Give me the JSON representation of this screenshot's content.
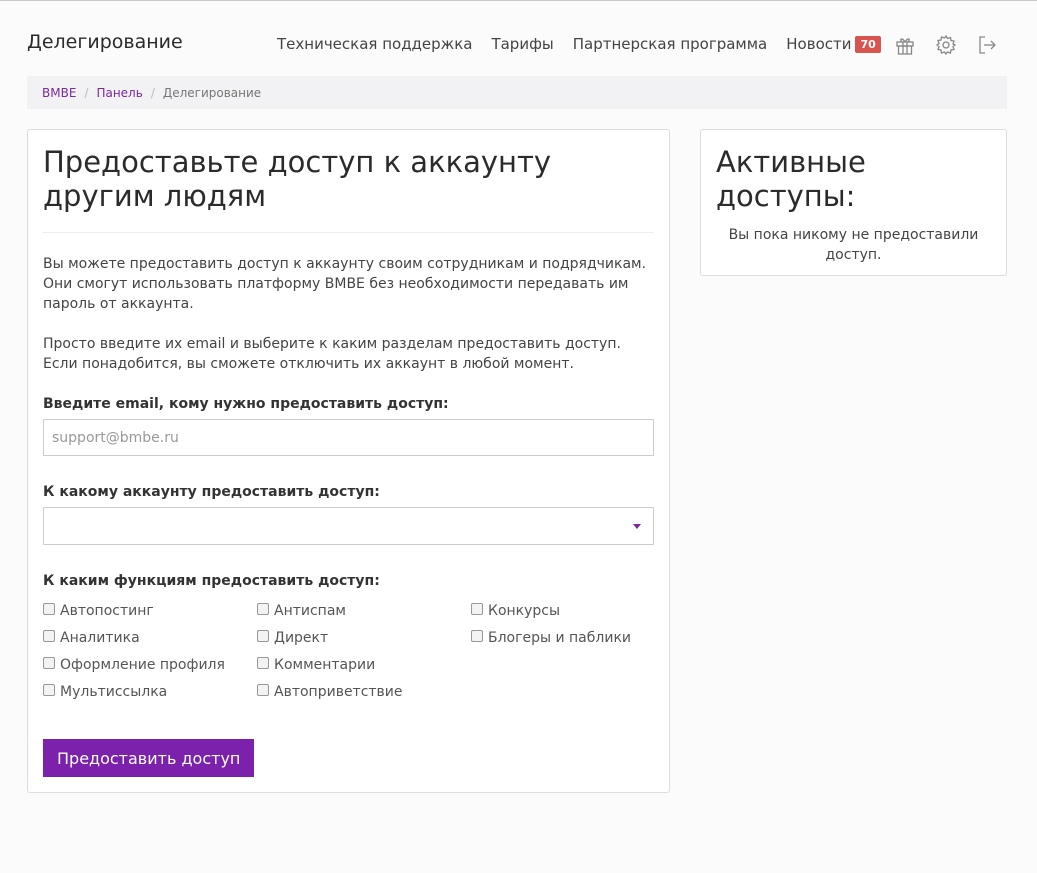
{
  "header": {
    "brand": "Делегирование",
    "nav": [
      "Техническая поддержка",
      "Тарифы",
      "Партнерская программа"
    ],
    "news_label": "Новости",
    "news_count": "70",
    "icons": [
      "gift-icon",
      "gear-icon",
      "logout-icon"
    ]
  },
  "breadcrumb": {
    "items": [
      "BMBE",
      "Панель",
      "Делегирование"
    ]
  },
  "main": {
    "title": "Предоставьте доступ к аккаунту другим людям",
    "para1_line1": "Вы можете предоставить доступ к аккаунту своим сотрудникам и подрядчикам.",
    "para1_line2": "Они смогут использовать платформу BMBE без необходимости передавать им пароль от аккаунта.",
    "para2_line1": "Просто введите их email и выберите к каким разделам предоставить доступ.",
    "para2_line2": "Если понадобится, вы сможете отключить их аккаунт в любой момент.",
    "email_label": "Введите email, кому нужно предоставить доступ:",
    "email_placeholder": "support@bmbe.ru",
    "email_value": "",
    "account_label": "К какому аккаунту предоставить доступ:",
    "account_value": "",
    "functions_label": "К каким функциям предоставить доступ:",
    "functions": [
      "Автопостинг",
      "Аналитика",
      "Оформление профиля",
      "Мультиссылка",
      "Антиспам",
      "Директ",
      "Комментарии",
      "Автоприветствие",
      "Конкурсы",
      "Блогеры и паблики"
    ],
    "submit_label": "Предоставить доступ"
  },
  "side": {
    "title": "Активные доступы:",
    "empty_text": "Вы пока никому не предоставили доступ."
  },
  "colors": {
    "accent": "#7b21ac",
    "badge": "#d9534f",
    "link": "#7b2a9b"
  }
}
